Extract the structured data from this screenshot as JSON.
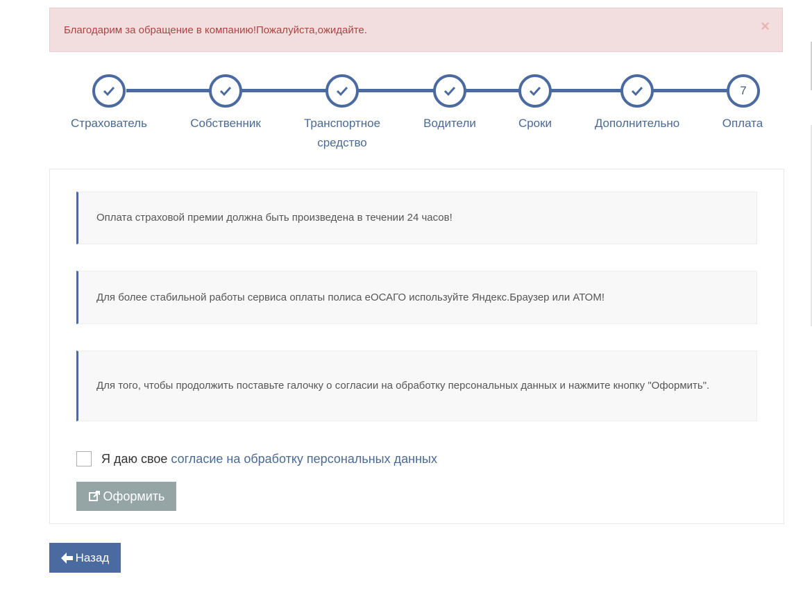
{
  "alert": {
    "message": "Благодарим за обращение в компанию!Пожалуйста,ожидайте.",
    "close_symbol": "×"
  },
  "steps": [
    {
      "label": "Страхователь",
      "status": "done"
    },
    {
      "label": "Собственник",
      "status": "done"
    },
    {
      "label": "Транспортное средство",
      "status": "done"
    },
    {
      "label": "Водители",
      "status": "done"
    },
    {
      "label": "Сроки",
      "status": "done"
    },
    {
      "label": "Дополнительно",
      "status": "done"
    },
    {
      "label": "Оплата",
      "status": "current",
      "number": "7"
    }
  ],
  "notices": [
    "Оплата страховой премии должна быть произведена в течении 24 часов!",
    "Для более стабильной работы сервиса оплаты полиса еОСАГО используйте Яндекс.Браузер или АТОМ!",
    "Для того, чтобы продолжить поставьте галочку о согласии на обработку персональных данных и нажмите кнопку \"Оформить\"."
  ],
  "consent": {
    "checked": false,
    "prefix": "Я даю свое",
    "link_text": "согласие на обработку персональных данных"
  },
  "buttons": {
    "submit_label": "Оформить",
    "submit_icon": "external-link-icon",
    "back_label": "Назад",
    "back_icon": "arrow-left-icon"
  },
  "colors": {
    "accent": "#4a6aa0",
    "alert_bg": "#f2dede",
    "alert_text": "#a94442",
    "submit_disabled": "#95a5a6"
  }
}
